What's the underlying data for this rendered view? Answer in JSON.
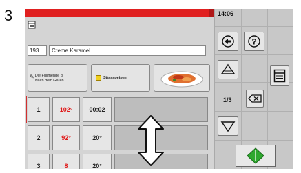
{
  "figure_label": "3",
  "colors": {
    "accent_red": "#e02020",
    "panel": "#d4d4d4",
    "start_green": "#2ea82e"
  },
  "status": {
    "time": "14:06"
  },
  "header": {
    "icon": "document-icon"
  },
  "program": {
    "number": "193",
    "name": "Creme Karamel"
  },
  "tiles": {
    "fill_hint_line1": "Die Füllmenge d",
    "fill_hint_line2": "Nach dem Garen",
    "category": "Süssspeisen",
    "image_icon": "food-plate-icon"
  },
  "steps": [
    {
      "index": "1",
      "temp": "102°",
      "time": "00:02",
      "active": true
    },
    {
      "index": "2",
      "temp": "92°",
      "time": "20°",
      "active": false
    },
    {
      "index": "3",
      "temp": "8",
      "time": "20°",
      "active": false
    }
  ],
  "nav": {
    "back_icon": "back-arrow-icon",
    "help_icon": "question-icon",
    "up_icon": "arrow-up-icon",
    "save_icon": "list-icon",
    "delete_icon": "delete-key-icon",
    "down_icon": "arrow-down-icon",
    "start_icon": "start-diamond-icon",
    "page_indicator": "1/3"
  }
}
